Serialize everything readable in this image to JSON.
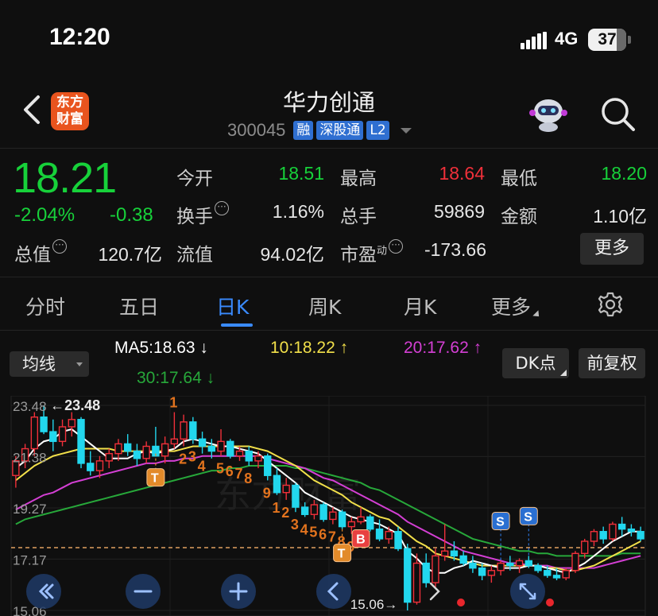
{
  "status": {
    "time": "12:20",
    "network": "4G",
    "battery": "37"
  },
  "header": {
    "logo_line1": "东方",
    "logo_line2": "财富",
    "name": "华力创通",
    "code": "300045",
    "tags": [
      "融",
      "深股通",
      "L2"
    ]
  },
  "quote": {
    "price": "18.21",
    "change_pct": "-2.04%",
    "change": "-0.38",
    "open_label": "今开",
    "open": "18.51",
    "high_label": "最高",
    "high": "18.64",
    "low_label": "最低",
    "low": "18.20",
    "turnover_label": "换手",
    "turnover": "1.16%",
    "volume_label": "总手",
    "volume": "59869",
    "amount_label": "金额",
    "amount": "1.10亿",
    "mcap_label": "总值",
    "mcap": "120.7亿",
    "float_label": "流值",
    "float": "94.02亿",
    "pe_label": "市盈",
    "pe_sup": "动",
    "pe": "-173.66",
    "more_label": "更多",
    "colors": {
      "up": "#f0303a",
      "down": "#17d13a"
    }
  },
  "tabs": [
    {
      "label": "分时"
    },
    {
      "label": "五日"
    },
    {
      "label": "日K",
      "active": true
    },
    {
      "label": "周K"
    },
    {
      "label": "月K"
    },
    {
      "label": "更多"
    }
  ],
  "ma_row": {
    "selector": "均线",
    "ma5": "MA5:18.63",
    "ma5_arrow": "↓",
    "ma10": "10:18.22",
    "ma10_arrow": "↑",
    "ma20": "20:17.62",
    "ma20_arrow": "↑",
    "ma30": "30:17.64",
    "ma30_arrow": "↓",
    "dk_label": "DK点",
    "adjust_label": "前复权"
  },
  "chart_data": {
    "type": "candlestick",
    "y_ticks": [
      "23.48",
      "21.38",
      "19.27",
      "17.17",
      "15.06"
    ],
    "ylim": [
      15.06,
      23.48
    ],
    "max_label": "23.48",
    "min_label": "15.06",
    "current_line": 17.64,
    "colors": {
      "up": "#f0303a",
      "down": "#22d7ee",
      "ma5": "#ffffff",
      "ma10": "#f2e04a",
      "ma20": "#d43fd4",
      "ma30": "#27a83a",
      "signal_T": "#e28a2a",
      "signal_S": "#2a6fd1",
      "signal_B": "#e84040"
    },
    "candles": [
      [
        20.6,
        21.4,
        20.1,
        21.2
      ],
      [
        21.2,
        21.9,
        20.9,
        21.7
      ],
      [
        21.7,
        23.2,
        21.4,
        23.0
      ],
      [
        23.0,
        23.48,
        22.3,
        22.4
      ],
      [
        22.4,
        22.9,
        21.6,
        22.0
      ],
      [
        22.0,
        22.9,
        21.8,
        22.6
      ],
      [
        22.6,
        23.2,
        22.2,
        22.9
      ],
      [
        22.9,
        23.0,
        20.9,
        21.1
      ],
      [
        21.1,
        21.6,
        20.6,
        20.8
      ],
      [
        20.8,
        21.4,
        20.5,
        21.2
      ],
      [
        21.2,
        21.7,
        20.9,
        21.5
      ],
      [
        21.5,
        22.1,
        21.2,
        21.9
      ],
      [
        21.9,
        22.3,
        21.4,
        21.6
      ],
      [
        21.6,
        21.9,
        21.0,
        21.3
      ],
      [
        21.3,
        22.0,
        21.1,
        21.8
      ],
      [
        21.8,
        22.6,
        21.5,
        21.4
      ],
      [
        21.4,
        22.2,
        21.1,
        21.9
      ],
      [
        21.9,
        23.2,
        21.7,
        22.1
      ],
      [
        22.1,
        23.1,
        21.8,
        22.8
      ],
      [
        22.8,
        23.0,
        21.9,
        22.1
      ],
      [
        22.1,
        22.4,
        21.5,
        21.8
      ],
      [
        21.8,
        22.1,
        21.3,
        21.6
      ],
      [
        21.6,
        22.5,
        21.4,
        22.0
      ],
      [
        22.0,
        22.1,
        21.3,
        21.4
      ],
      [
        21.4,
        21.8,
        21.2,
        21.6
      ],
      [
        21.6,
        21.8,
        21.0,
        21.2
      ],
      [
        21.2,
        21.6,
        20.9,
        21.4
      ],
      [
        21.4,
        21.5,
        20.4,
        20.6
      ],
      [
        20.6,
        20.9,
        19.8,
        19.9
      ],
      [
        19.9,
        20.5,
        19.6,
        20.2
      ],
      [
        20.2,
        20.3,
        19.1,
        19.3
      ],
      [
        19.3,
        19.5,
        18.9,
        19.0
      ],
      [
        19.0,
        19.6,
        18.8,
        19.4
      ],
      [
        19.4,
        19.5,
        18.7,
        18.8
      ],
      [
        18.8,
        19.3,
        18.6,
        19.1
      ],
      [
        19.1,
        19.2,
        18.4,
        18.5
      ],
      [
        18.5,
        18.9,
        18.2,
        18.7
      ],
      [
        18.7,
        19.3,
        18.6,
        18.9
      ],
      [
        18.9,
        19.0,
        18.3,
        18.4
      ],
      [
        18.4,
        18.8,
        17.9,
        18.0
      ],
      [
        18.0,
        18.5,
        17.8,
        18.3
      ],
      [
        18.3,
        18.5,
        17.5,
        17.6
      ],
      [
        17.6,
        17.8,
        15.06,
        15.4
      ],
      [
        15.4,
        17.4,
        15.3,
        17.0
      ],
      [
        17.0,
        17.4,
        16.0,
        16.2
      ],
      [
        16.2,
        17.6,
        16.0,
        17.3
      ],
      [
        17.3,
        18.6,
        17.1,
        17.5
      ],
      [
        17.5,
        17.9,
        17.1,
        17.3
      ],
      [
        17.3,
        17.5,
        16.9,
        17.0
      ],
      [
        17.0,
        17.3,
        16.6,
        16.8
      ],
      [
        16.8,
        17.0,
        16.3,
        16.5
      ],
      [
        16.5,
        16.9,
        16.2,
        16.7
      ],
      [
        16.7,
        17.1,
        16.5,
        17.0
      ],
      [
        17.0,
        17.3,
        16.7,
        16.9
      ],
      [
        16.9,
        17.2,
        16.6,
        17.1
      ],
      [
        17.1,
        17.3,
        16.8,
        16.9
      ],
      [
        16.9,
        17.0,
        16.6,
        16.7
      ],
      [
        16.7,
        16.9,
        16.4,
        16.5
      ],
      [
        16.5,
        16.8,
        16.3,
        16.4
      ],
      [
        16.4,
        16.8,
        16.3,
        16.7
      ],
      [
        16.7,
        17.5,
        16.6,
        17.4
      ],
      [
        17.4,
        18.0,
        17.2,
        17.9
      ],
      [
        17.9,
        18.4,
        17.7,
        18.3
      ],
      [
        18.3,
        18.5,
        17.8,
        18.0
      ],
      [
        18.0,
        18.7,
        17.9,
        18.6
      ],
      [
        18.6,
        18.9,
        18.1,
        18.4
      ],
      [
        18.4,
        18.6,
        18.1,
        18.3
      ],
      [
        18.3,
        18.5,
        17.9,
        18.0
      ]
    ],
    "ma5": [
      20.9,
      21.2,
      21.7,
      22.0,
      22.1,
      22.4,
      22.5,
      22.2,
      21.9,
      21.6,
      21.3,
      21.3,
      21.3,
      21.5,
      21.6,
      21.5,
      21.6,
      21.7,
      22.0,
      22.1,
      22.0,
      21.9,
      21.8,
      21.8,
      21.7,
      21.6,
      21.5,
      21.2,
      20.9,
      20.6,
      20.3,
      19.9,
      19.7,
      19.5,
      19.3,
      19.1,
      18.9,
      18.8,
      18.7,
      18.6,
      18.4,
      18.2,
      17.5,
      17.2,
      16.8,
      16.6,
      16.6,
      16.8,
      16.9,
      17.1,
      17.0,
      16.9,
      16.8,
      16.8,
      16.8,
      16.9,
      16.9,
      16.8,
      16.7,
      16.6,
      16.8,
      17.0,
      17.3,
      17.6,
      17.9,
      18.1,
      18.3,
      18.3
    ],
    "ma10": [
      20.4,
      20.7,
      21.0,
      21.2,
      21.4,
      21.5,
      21.6,
      21.7,
      21.7,
      21.7,
      21.7,
      21.6,
      21.6,
      21.6,
      21.6,
      21.6,
      21.6,
      21.6,
      21.7,
      21.8,
      21.8,
      21.8,
      21.8,
      21.8,
      21.8,
      21.8,
      21.7,
      21.6,
      21.4,
      21.2,
      21.0,
      20.7,
      20.4,
      20.2,
      20.0,
      19.8,
      19.5,
      19.3,
      19.1,
      18.9,
      18.8,
      18.5,
      18.2,
      17.9,
      17.7,
      17.4,
      17.3,
      17.2,
      17.1,
      17.0,
      16.9,
      16.9,
      16.9,
      16.9,
      16.9,
      16.9,
      16.9,
      16.8,
      16.8,
      16.7,
      16.7,
      16.8,
      16.9,
      17.1,
      17.3,
      17.5,
      17.7,
      17.9
    ],
    "ma20": [
      19.2,
      19.4,
      19.6,
      19.8,
      19.9,
      20.1,
      20.3,
      20.4,
      20.5,
      20.6,
      20.7,
      20.8,
      20.9,
      21.0,
      21.1,
      21.1,
      21.2,
      21.2,
      21.3,
      21.3,
      21.4,
      21.4,
      21.4,
      21.4,
      21.4,
      21.4,
      21.4,
      21.3,
      21.2,
      21.1,
      21.0,
      20.9,
      20.7,
      20.5,
      20.4,
      20.2,
      20.0,
      19.8,
      19.6,
      19.4,
      19.2,
      19.0,
      18.7,
      18.5,
      18.3,
      18.1,
      17.9,
      17.7,
      17.5,
      17.4,
      17.3,
      17.2,
      17.1,
      17.0,
      17.0,
      16.9,
      16.9,
      16.9,
      16.8,
      16.8,
      16.8,
      16.8,
      16.8,
      16.9,
      17.0,
      17.1,
      17.2,
      17.3
    ],
    "ma30": [
      18.6,
      18.8,
      18.9,
      19.0,
      19.1,
      19.2,
      19.3,
      19.4,
      19.5,
      19.6,
      19.7,
      19.8,
      19.9,
      20.0,
      20.1,
      20.2,
      20.3,
      20.4,
      20.5,
      20.6,
      20.7,
      20.8,
      20.8,
      20.9,
      20.9,
      21.0,
      21.0,
      21.0,
      21.0,
      21.0,
      20.9,
      20.9,
      20.8,
      20.7,
      20.6,
      20.5,
      20.4,
      20.3,
      20.1,
      20.0,
      19.8,
      19.6,
      19.4,
      19.2,
      19.0,
      18.8,
      18.6,
      18.4,
      18.2,
      18.0,
      17.9,
      17.8,
      17.7,
      17.6,
      17.5,
      17.5,
      17.4,
      17.4,
      17.3,
      17.3,
      17.3,
      17.3,
      17.3,
      17.3,
      17.3,
      17.4,
      17.4,
      17.4
    ],
    "td_counts": [
      {
        "i": 17,
        "n": "1",
        "pos": "above"
      },
      {
        "i": 18,
        "n": "2",
        "pos": "below"
      },
      {
        "i": 19,
        "n": "3",
        "pos": "below"
      },
      {
        "i": 20,
        "n": "4",
        "pos": "below"
      },
      {
        "i": 22,
        "n": "5",
        "pos": "below"
      },
      {
        "i": 23,
        "n": "6",
        "pos": "below"
      },
      {
        "i": 24,
        "n": "7",
        "pos": "below"
      },
      {
        "i": 25,
        "n": "8",
        "pos": "below"
      },
      {
        "i": 27,
        "n": "9",
        "pos": "below"
      },
      {
        "i": 28,
        "n": "1",
        "pos": "below"
      },
      {
        "i": 29,
        "n": "2",
        "pos": "below"
      },
      {
        "i": 30,
        "n": "3",
        "pos": "below"
      },
      {
        "i": 31,
        "n": "4",
        "pos": "below"
      },
      {
        "i": 32,
        "n": "5",
        "pos": "below"
      },
      {
        "i": 33,
        "n": "6",
        "pos": "below"
      },
      {
        "i": 34,
        "n": "7",
        "pos": "below"
      },
      {
        "i": 35,
        "n": "8",
        "pos": "below"
      },
      {
        "i": 36,
        "n": "9",
        "pos": "below"
      }
    ],
    "signals": [
      {
        "type": "T",
        "i": 15
      },
      {
        "type": "T",
        "i": 35
      },
      {
        "type": "B",
        "i": 37
      },
      {
        "type": "S",
        "i": 52
      },
      {
        "type": "S",
        "i": 55
      }
    ],
    "nav_buttons": [
      "fast-back",
      "zoom-out",
      "zoom-in",
      "prev"
    ]
  }
}
